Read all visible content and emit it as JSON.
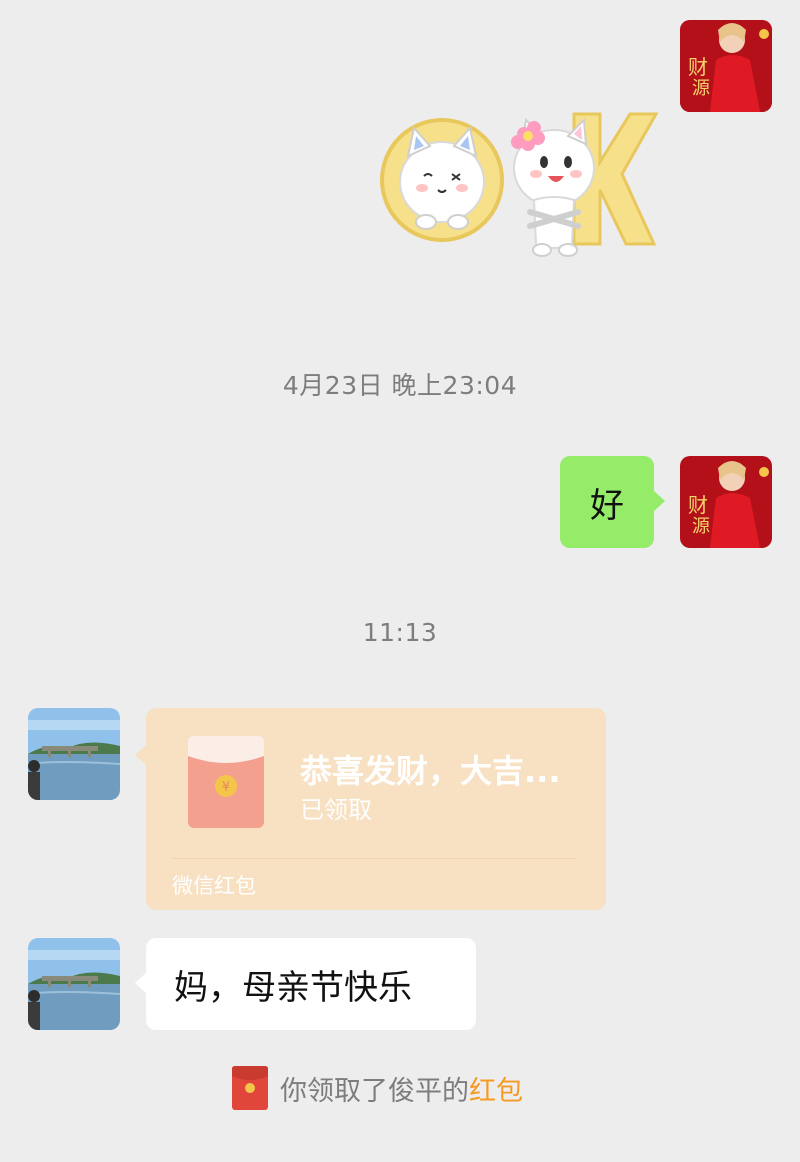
{
  "messages": [
    {
      "type": "sticker",
      "from": "self",
      "sticker_name": "cat-ok-sticker",
      "text": "OK"
    },
    {
      "type": "timestamp",
      "text": "4月23日 晚上23:04"
    },
    {
      "type": "text",
      "from": "self",
      "text": "好"
    },
    {
      "type": "timestamp",
      "text": "11:13"
    },
    {
      "type": "red_packet",
      "from": "other",
      "title": "恭喜发财，大吉...",
      "status": "已领取",
      "footer": "微信红包",
      "symbol": "¥"
    },
    {
      "type": "text",
      "from": "other",
      "text": "妈，母亲节快乐"
    }
  ],
  "notice": {
    "prefix": "你领取了俊平的",
    "link": "红包"
  },
  "colors": {
    "background": "#ededed",
    "self_bubble": "#95ec69",
    "red_packet_bg": "#f8e0c3",
    "link": "#f59a23",
    "timestamp": "#7d7d7d"
  }
}
